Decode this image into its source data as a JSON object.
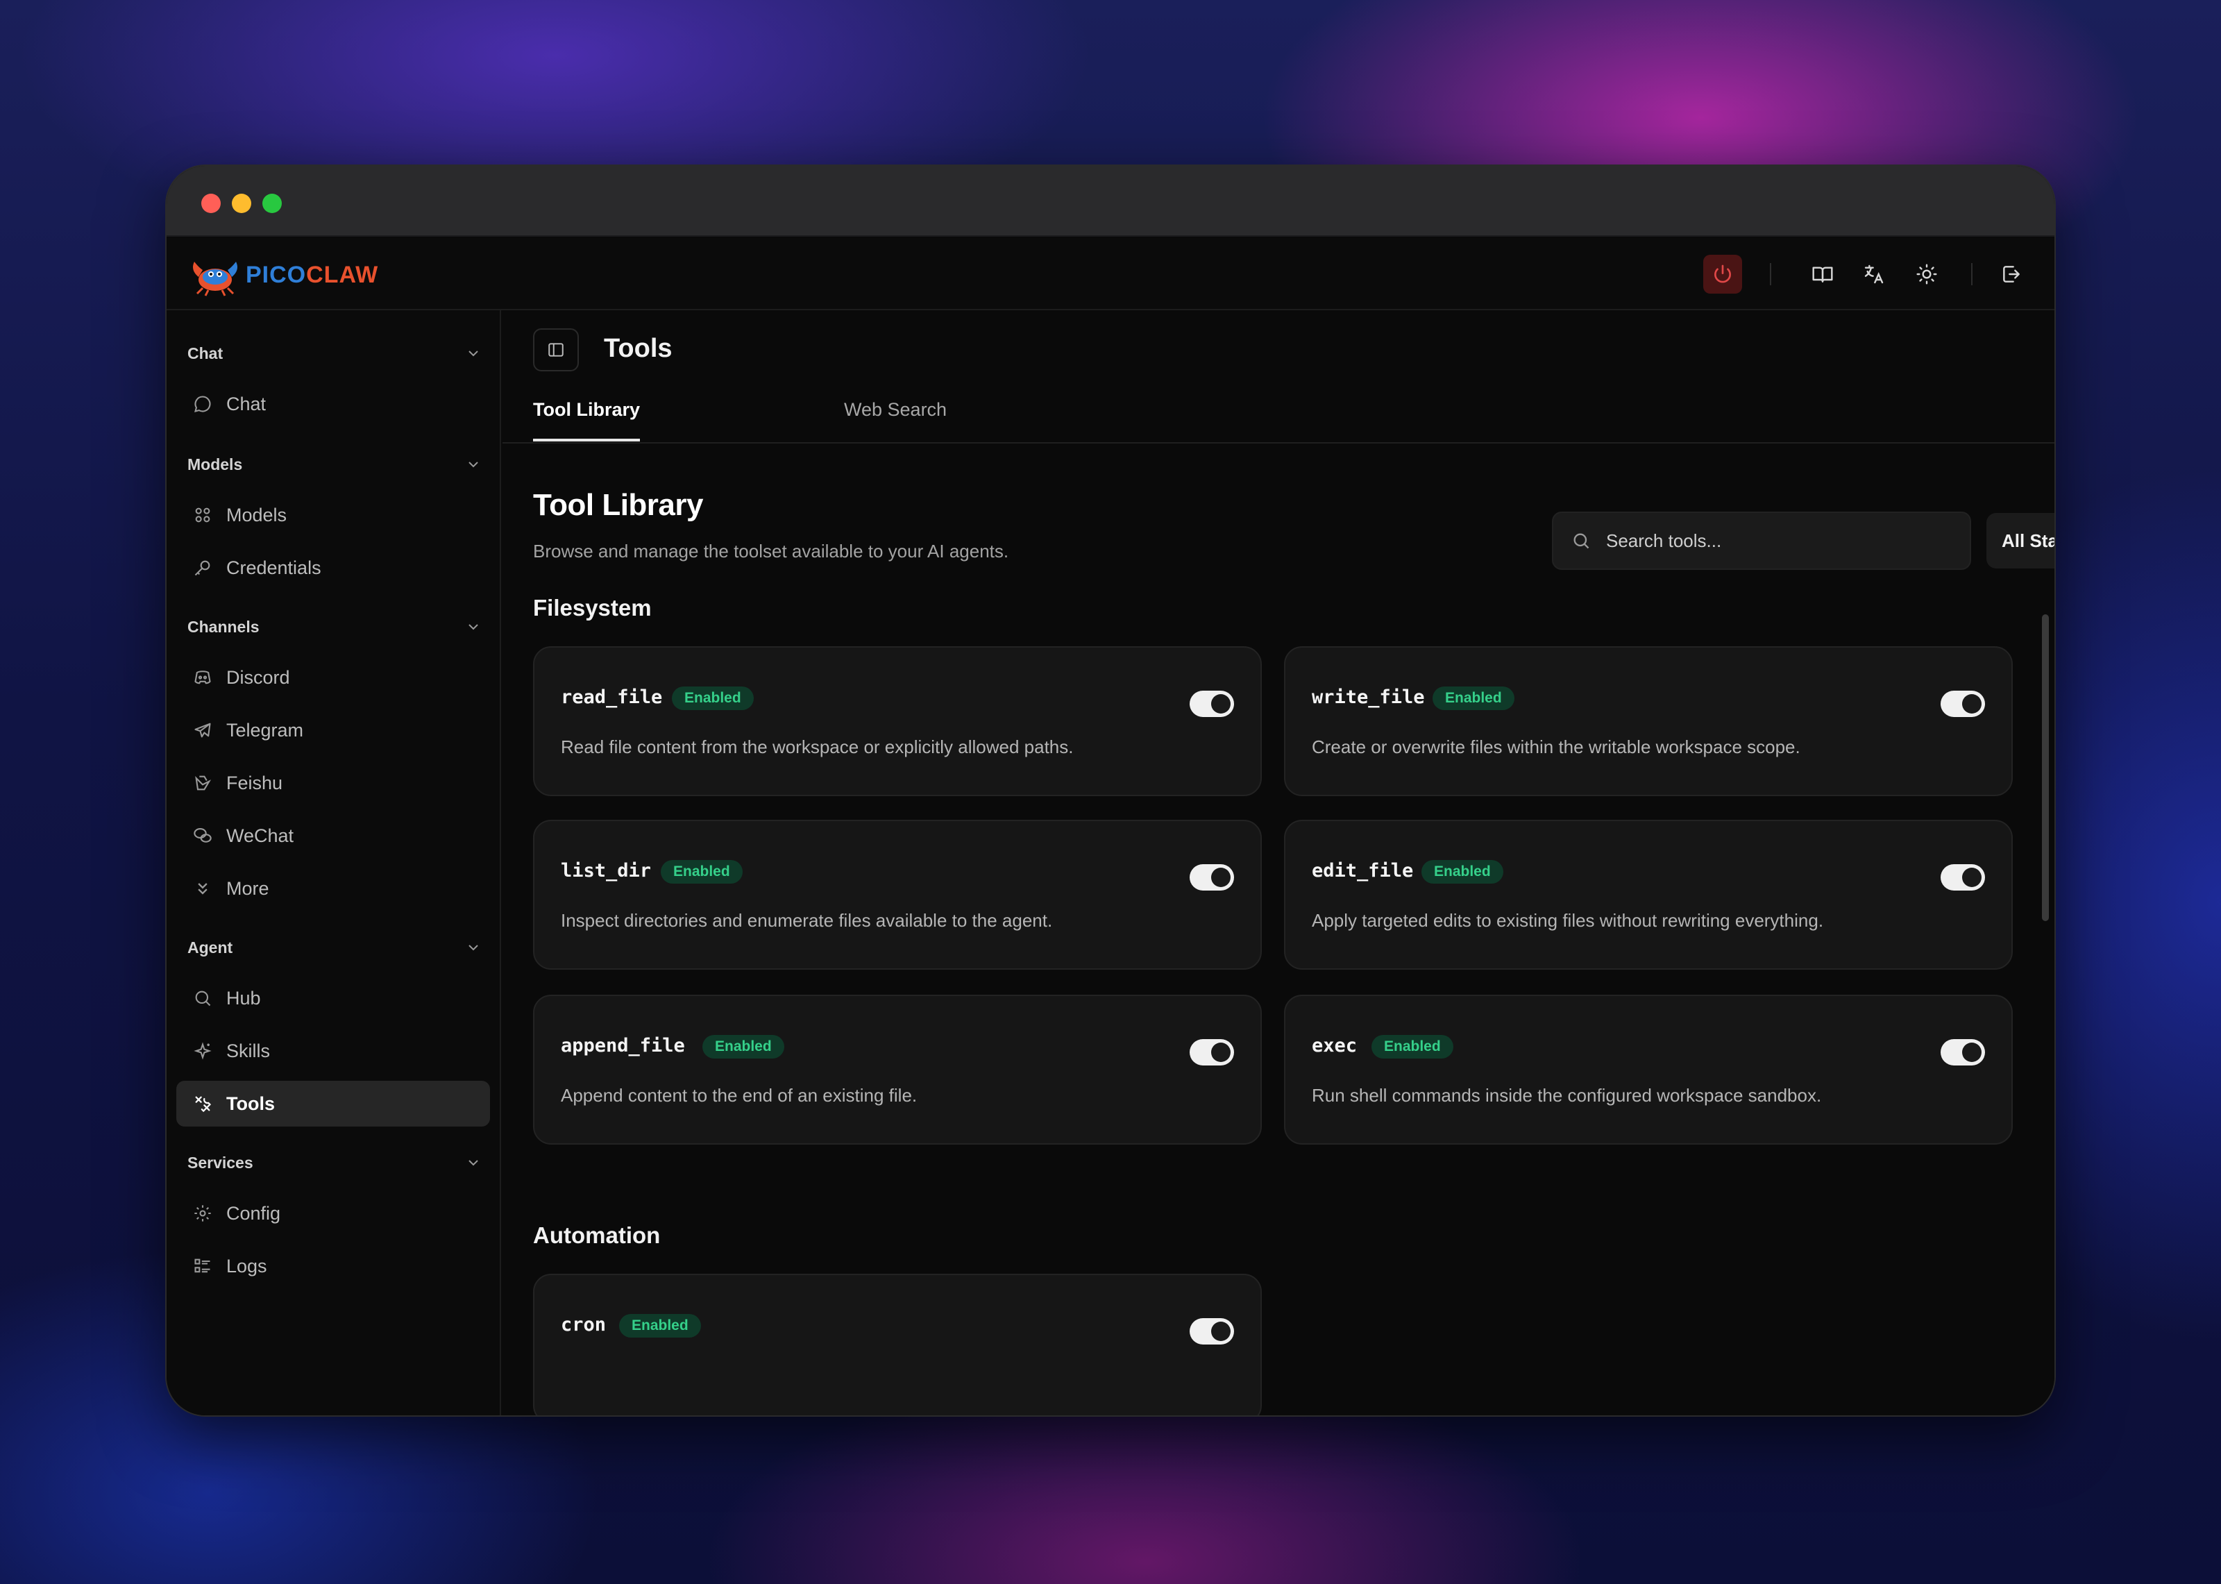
{
  "app": {
    "logo_part1": "PICO",
    "logo_part2": "CLAW",
    "brand_colors": {
      "pico": "#2f7fd8",
      "claw": "#e8512d"
    }
  },
  "header": {
    "icons": [
      "power-icon",
      "book-icon",
      "translate-icon",
      "sun-icon",
      "logout-icon"
    ]
  },
  "sidebar": {
    "sections": [
      {
        "title": "Chat",
        "items": [
          {
            "label": "Chat",
            "icon": "chat-bubble-icon"
          }
        ]
      },
      {
        "title": "Models",
        "items": [
          {
            "label": "Models",
            "icon": "models-icon"
          },
          {
            "label": "Credentials",
            "icon": "key-icon"
          }
        ]
      },
      {
        "title": "Channels",
        "items": [
          {
            "label": "Discord",
            "icon": "discord-icon"
          },
          {
            "label": "Telegram",
            "icon": "telegram-icon"
          },
          {
            "label": "Feishu",
            "icon": "feishu-icon"
          },
          {
            "label": "WeChat",
            "icon": "wechat-icon"
          },
          {
            "label": "More",
            "icon": "chevrons-down-icon"
          }
        ]
      },
      {
        "title": "Agent",
        "items": [
          {
            "label": "Hub",
            "icon": "search-icon"
          },
          {
            "label": "Skills",
            "icon": "sparkles-icon"
          },
          {
            "label": "Tools",
            "icon": "tools-icon",
            "active": true
          }
        ]
      },
      {
        "title": "Services",
        "items": [
          {
            "label": "Config",
            "icon": "gear-icon"
          },
          {
            "label": "Logs",
            "icon": "list-icon"
          }
        ]
      }
    ]
  },
  "main": {
    "page_title": "Tools",
    "tabs": [
      {
        "label": "Tool Library",
        "active": true
      },
      {
        "label": "Web Search",
        "active": false
      }
    ],
    "library_title": "Tool Library",
    "library_subtitle": "Browse and manage the toolset available to your AI agents.",
    "search": {
      "placeholder": "Search tools...",
      "value": ""
    },
    "status_filter": {
      "selected": "All Status"
    },
    "groups": [
      {
        "title": "Filesystem",
        "tools": [
          {
            "name": "read_file",
            "status": "Enabled",
            "description": "Read file content from the workspace or explicitly allowed paths.",
            "enabled": true
          },
          {
            "name": "write_file",
            "status": "Enabled",
            "description": "Create or overwrite files within the writable workspace scope.",
            "enabled": true
          },
          {
            "name": "list_dir",
            "status": "Enabled",
            "description": "Inspect directories and enumerate files available to the agent.",
            "enabled": true
          },
          {
            "name": "edit_file",
            "status": "Enabled",
            "description": "Apply targeted edits to existing files without rewriting everything.",
            "enabled": true
          },
          {
            "name": "append_file",
            "status": "Enabled",
            "description": "Append content to the end of an existing file.",
            "enabled": true
          },
          {
            "name": "exec",
            "status": "Enabled",
            "description": "Run shell commands inside the configured workspace sandbox.",
            "enabled": true
          }
        ]
      },
      {
        "title": "Automation",
        "tools": [
          {
            "name": "cron",
            "status": "Enabled",
            "description": "",
            "enabled": true
          }
        ]
      }
    ]
  },
  "colors": {
    "accent_green": "#35d08a",
    "badge_bg": "#0f3a29",
    "power_bg": "#4a1414",
    "power_icon": "#e04848"
  }
}
